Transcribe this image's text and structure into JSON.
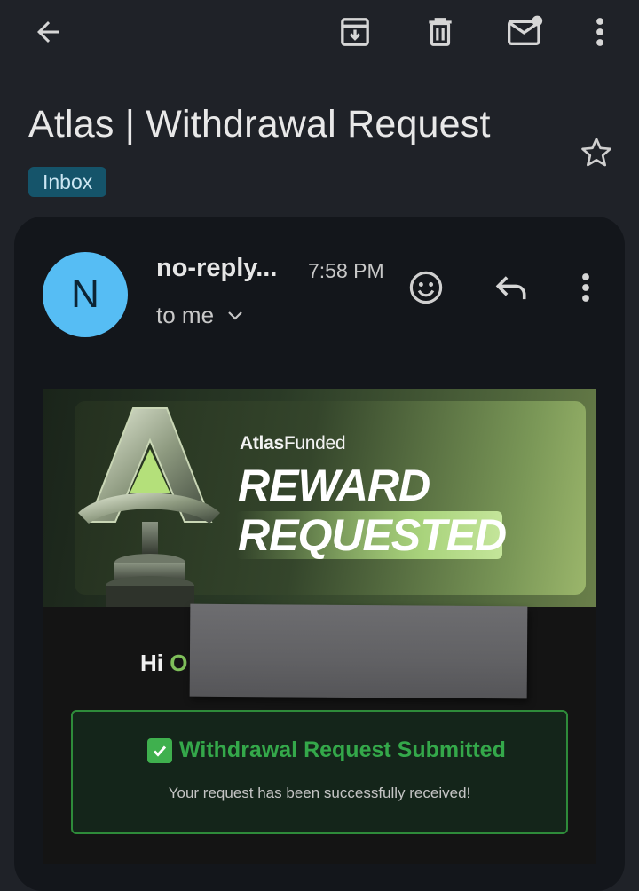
{
  "toolbar": {
    "back_icon": "arrow-left-icon",
    "archive_icon": "archive-icon",
    "delete_icon": "trash-icon",
    "mark_unread_icon": "mail-unread-icon",
    "more_icon": "more-vert-icon"
  },
  "subject": "Atlas | Withdrawal Request",
  "label": "Inbox",
  "message": {
    "avatar_initial": "N",
    "sender": "no-reply...",
    "time": "7:58 PM",
    "recipient": "to me"
  },
  "banner": {
    "brand_prefix": "Atlas",
    "brand_suffix": "Funded",
    "headline_line1": "REWARD",
    "headline_line2": "REQUESTED"
  },
  "body": {
    "greeting_prefix": "Hi ",
    "greeting_visible_initial": "O",
    "status_title": "Withdrawal Request Submitted",
    "status_subtitle": "Your request has been successfully received!"
  },
  "colors": {
    "background": "#1f2228",
    "card": "#13161b",
    "avatar": "#56bdf4",
    "label_chip": "#15546a",
    "success_green": "#34a84a"
  }
}
